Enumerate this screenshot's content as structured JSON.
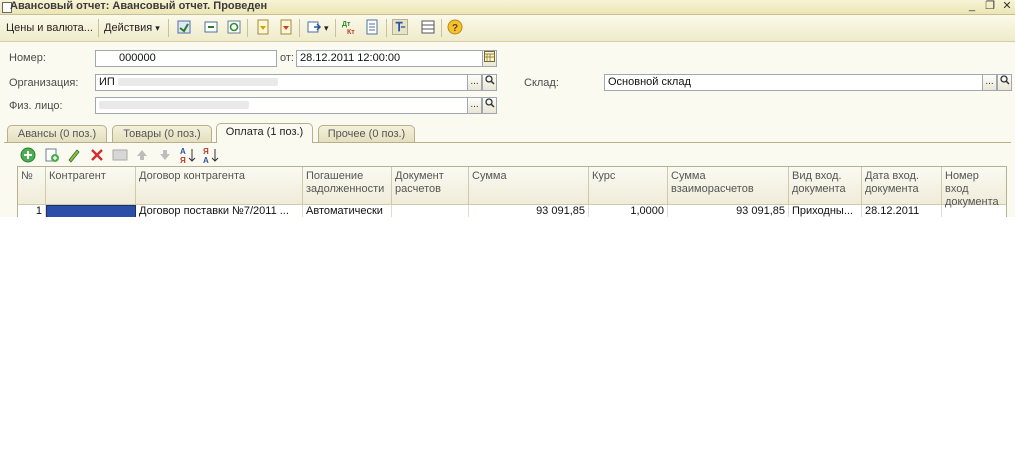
{
  "window": {
    "title": "Авансовый отчет: Авансовый отчет. Проведен",
    "minimize": "_",
    "restore": "❐",
    "close": "✕"
  },
  "toolbar": {
    "menu1": "Цены и валюта...",
    "menu2": "Действия",
    "menu2_arrow": "▾",
    "icons": [
      "post-and-close-icon",
      "document-icon",
      "refresh-icon",
      "save-icon",
      "print-icon",
      "go-to-icon",
      "dt-kt-icon",
      "structure-icon",
      "select-icon",
      "table-icon",
      "help-icon"
    ]
  },
  "form": {
    "number_label": "Номер:",
    "number_value": "000000",
    "date_label": "от:",
    "date_value": "28.12.2011 12:00:00",
    "org_label": "Организация:",
    "org_value": "ИП",
    "warehouse_label": "Склад:",
    "warehouse_value": "Основной склад",
    "person_label": "Физ. лицо:",
    "person_value": "",
    "btn_select": "...",
    "btn_search": "🔍"
  },
  "tabs": [
    {
      "label": "Авансы (0 поз.)",
      "active": false
    },
    {
      "label": "Товары (0 поз.)",
      "active": false
    },
    {
      "label": "Оплата (1 поз.)",
      "active": true
    },
    {
      "label": "Прочее (0 поз.)",
      "active": false
    }
  ],
  "grid_toolbar_icons": [
    "add-row-icon",
    "copy-row-icon",
    "edit-row-icon",
    "delete-row-icon",
    "end-edit-icon",
    "move-up-icon",
    "move-down-icon",
    "sort-asc-icon",
    "sort-desc-icon"
  ],
  "table": {
    "headers": [
      "№",
      "Контрагент",
      "Договор контрагента",
      "Погашение задолженности",
      "Документ расчетов",
      "Сумма",
      "Курс",
      "Сумма взаиморасчетов",
      "Вид вход. документа",
      "Дата вход. документа",
      "Номер вход документа"
    ],
    "rows": [
      [
        "1",
        "",
        "Договор поставки №7/2011 ...",
        "Автоматически",
        "",
        "93 091,85",
        "1,0000",
        "93 091,85",
        "Приходны...",
        "28.12.2011",
        ""
      ]
    ]
  },
  "colors": {
    "window_bg": "#fbfaf0",
    "title_bg": "#ece6b4",
    "accent_selection": "#2b4fa8"
  }
}
